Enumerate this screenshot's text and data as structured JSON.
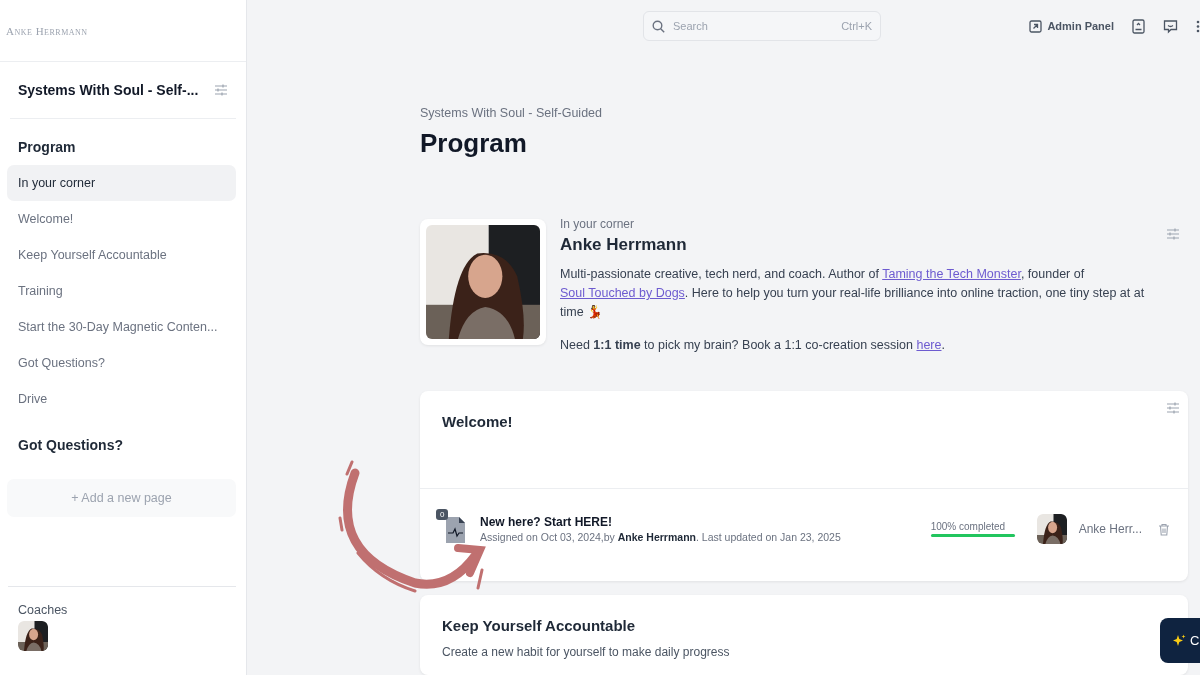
{
  "logo": {
    "text": "Anke Herrmann"
  },
  "sidebar": {
    "course_title": "Systems With Soul - Self-...",
    "sections": [
      {
        "heading": "Program",
        "items": [
          {
            "label": "In your corner",
            "selected": true
          },
          {
            "label": "Welcome!",
            "selected": false
          },
          {
            "label": "Keep Yourself Accountable",
            "selected": false
          },
          {
            "label": "Training",
            "selected": false
          },
          {
            "label": "Start the 30-Day Magnetic Conten...",
            "selected": false
          },
          {
            "label": "Got Questions?",
            "selected": false
          },
          {
            "label": "Drive",
            "selected": false
          }
        ]
      },
      {
        "heading": "Got Questions?"
      }
    ],
    "add_page": "+ Add a new page",
    "coaches_label": "Coaches"
  },
  "topbar": {
    "search": {
      "placeholder": "Search",
      "shortcut": "Ctrl+K"
    },
    "admin_panel": "Admin Panel"
  },
  "page": {
    "breadcrumb": "Systems With Soul - Self-Guided",
    "title": "Program"
  },
  "coach_card": {
    "eyebrow": "In your corner",
    "name": "Anke Herrmann",
    "paragraphs": [
      [
        {
          "kind": "text",
          "text": "Multi-passionate creative, tech nerd, and coach. Author of "
        },
        {
          "kind": "link",
          "text": "Taming the Tech Monster"
        },
        {
          "kind": "text",
          "text": ", founder of "
        },
        {
          "kind": "link",
          "text": "Soul Touched by Dogs"
        },
        {
          "kind": "text",
          "text": ". Here to help you turn your real-life brilliance into online traction, one tiny step at at time 💃"
        }
      ],
      [
        {
          "kind": "text",
          "text": "Need **1:1 time** to pick my brain? Book a 1:1 co-creation session "
        },
        {
          "kind": "link",
          "text": "here"
        },
        {
          "kind": "text",
          "text": "."
        }
      ]
    ]
  },
  "welcome_card": {
    "title": "Welcome!",
    "item": {
      "badge": "0",
      "title": "New here? Start HERE!",
      "meta": "Assigned on Oct 03, 2024,by **Anke Herrmann**. Last updated on Jan 23, 2025",
      "progress_label": "100% completed",
      "level": 1,
      "assignee": "Anke Herr..."
    }
  },
  "accountable_card": {
    "title": "Keep Yourself Accountable",
    "description": "Create a new habit for yourself to make daily progress"
  },
  "floating_button": {
    "label": "C"
  }
}
